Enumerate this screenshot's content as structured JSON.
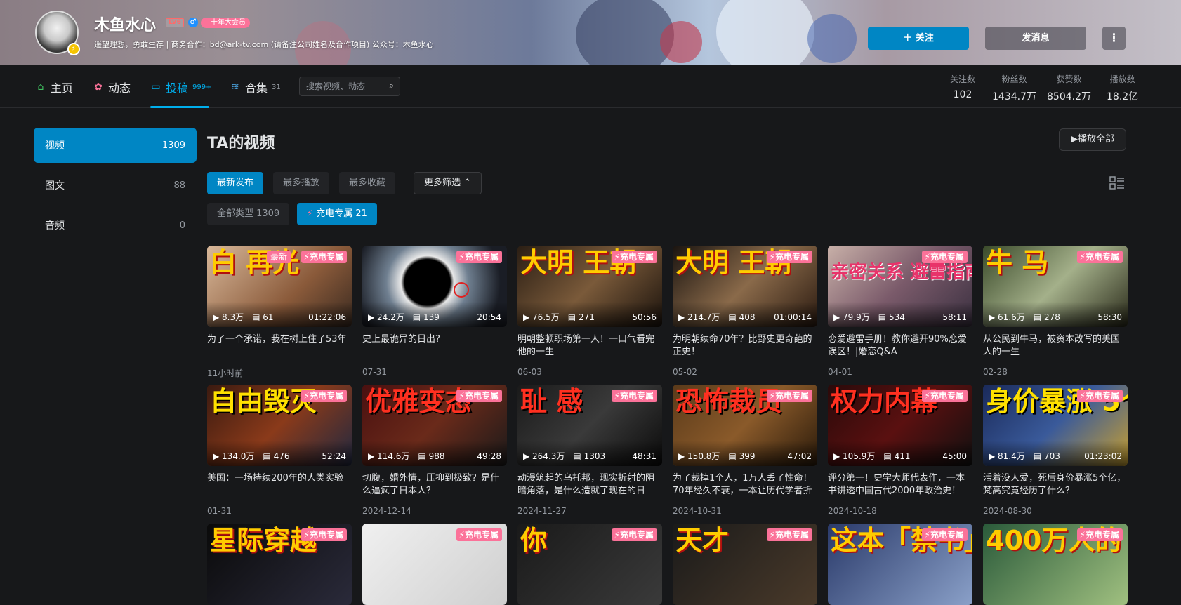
{
  "header": {
    "username": "木鱼水心",
    "level": "LV6",
    "gender_icon": "♂",
    "vip_label": "十年大会员",
    "signature": "遥望理想，勇敢生存 | 商务合作：bd@ark-tv.com (请备注公司姓名及合作项目) 公众号：木鱼水心",
    "follow_label": "关注",
    "message_label": "发消息"
  },
  "nav": {
    "home": "主页",
    "dynamic": "动态",
    "uploads": "投稿",
    "uploads_count": "999+",
    "collections": "合集",
    "collections_count": "31",
    "search_placeholder": "搜索视频、动态",
    "stats": [
      {
        "label": "关注数",
        "value": "102"
      },
      {
        "label": "粉丝数",
        "value": "1434.7万"
      },
      {
        "label": "获赞数",
        "value": "8504.2万"
      },
      {
        "label": "播放数",
        "value": "18.2亿"
      }
    ]
  },
  "sidebar": [
    {
      "label": "视频",
      "count": "1309"
    },
    {
      "label": "图文",
      "count": "88"
    },
    {
      "label": "音频",
      "count": "0"
    }
  ],
  "main": {
    "title": "TA的视频",
    "play_all": "播放全部",
    "sorts": [
      "最新发布",
      "最多播放",
      "最多收藏"
    ],
    "more_filter": "更多筛选",
    "type_all": "全部类型 1309",
    "type_charge": "充电专属 21"
  },
  "charge_tag": "充电专属",
  "new_tag": "最新",
  "videos": [
    {
      "overlay": "白 再光",
      "plays": "8.3万",
      "comments": "61",
      "duration": "01:22:06",
      "title": "为了一个承诺，我在树上住了53年",
      "date": "11小时前"
    },
    {
      "overlay": "",
      "plays": "24.2万",
      "comments": "139",
      "duration": "20:54",
      "title": "史上最诡异的日出?",
      "date": "07-31"
    },
    {
      "overlay": "大明 王朝",
      "plays": "76.5万",
      "comments": "271",
      "duration": "50:56",
      "title": "明朝整顿职场第一人！一口气看完他的一生",
      "date": "06-03"
    },
    {
      "overlay": "大明 王朝",
      "plays": "214.7万",
      "comments": "408",
      "duration": "01:00:14",
      "title": "为明朝续命70年？比野史更奇葩的正史！",
      "date": "05-02"
    },
    {
      "overlay": "亲密关系 避雷指南",
      "plays": "79.9万",
      "comments": "534",
      "duration": "58:11",
      "title": "恋爱避雷手册！教你避开90%恋爱误区！|婚恋Q&A",
      "date": "04-01"
    },
    {
      "overlay": "牛 马",
      "plays": "61.6万",
      "comments": "278",
      "duration": "58:30",
      "title": "从公民到牛马，被资本改写的美国人的一生",
      "date": "02-28"
    },
    {
      "overlay": "自由毁灭",
      "plays": "134.0万",
      "comments": "476",
      "duration": "52:24",
      "title": "美国：一场持续200年的人类实验",
      "date": "01-31"
    },
    {
      "overlay": "优雅变态",
      "plays": "114.6万",
      "comments": "988",
      "duration": "49:28",
      "title": "切腹，婚外情，压抑到极致？是什么逼疯了日本人？",
      "date": "2024-12-14"
    },
    {
      "overlay": "耻 感",
      "plays": "264.3万",
      "comments": "1303",
      "duration": "48:31",
      "title": "动漫筑起的乌托邦，现实折射的阴暗角落，是什么造就了现在的日本？",
      "date": "2024-11-27"
    },
    {
      "overlay": "恐怖裁员",
      "plays": "150.8万",
      "comments": "399",
      "duration": "47:02",
      "title": "为了裁掉1个人，1万人丢了性命！70年经久不衰，一本让历代学者折服的书",
      "date": "2024-10-31"
    },
    {
      "overlay": "权力内幕",
      "plays": "105.9万",
      "comments": "411",
      "duration": "45:00",
      "title": "评分第一！史学大师代表作，一本书讲透中国古代2000年政治史！",
      "date": "2024-10-18"
    },
    {
      "overlay": "身价暴涨 5个亿",
      "plays": "81.4万",
      "comments": "703",
      "duration": "01:23:02",
      "title": "活着没人爱，死后身价暴涨5个亿，梵高究竟经历了什么？",
      "date": "2024-08-30"
    },
    {
      "overlay": "星际穿越",
      "plays": "",
      "comments": "",
      "duration": "",
      "title": "",
      "date": ""
    },
    {
      "overlay": "",
      "plays": "",
      "comments": "",
      "duration": "",
      "title": "",
      "date": ""
    },
    {
      "overlay": "你",
      "plays": "",
      "comments": "",
      "duration": "",
      "title": "",
      "date": ""
    },
    {
      "overlay": "天才",
      "plays": "",
      "comments": "",
      "duration": "",
      "title": "",
      "date": ""
    },
    {
      "overlay": "这本「禁书」",
      "plays": "",
      "comments": "",
      "duration": "",
      "title": "",
      "date": ""
    },
    {
      "overlay": "400万人的",
      "plays": "",
      "comments": "",
      "duration": "",
      "title": "",
      "date": ""
    }
  ],
  "colors": {
    "accent": "#00aeec",
    "charge_pink": "#fb7299",
    "button_blue": "#0086c4"
  }
}
